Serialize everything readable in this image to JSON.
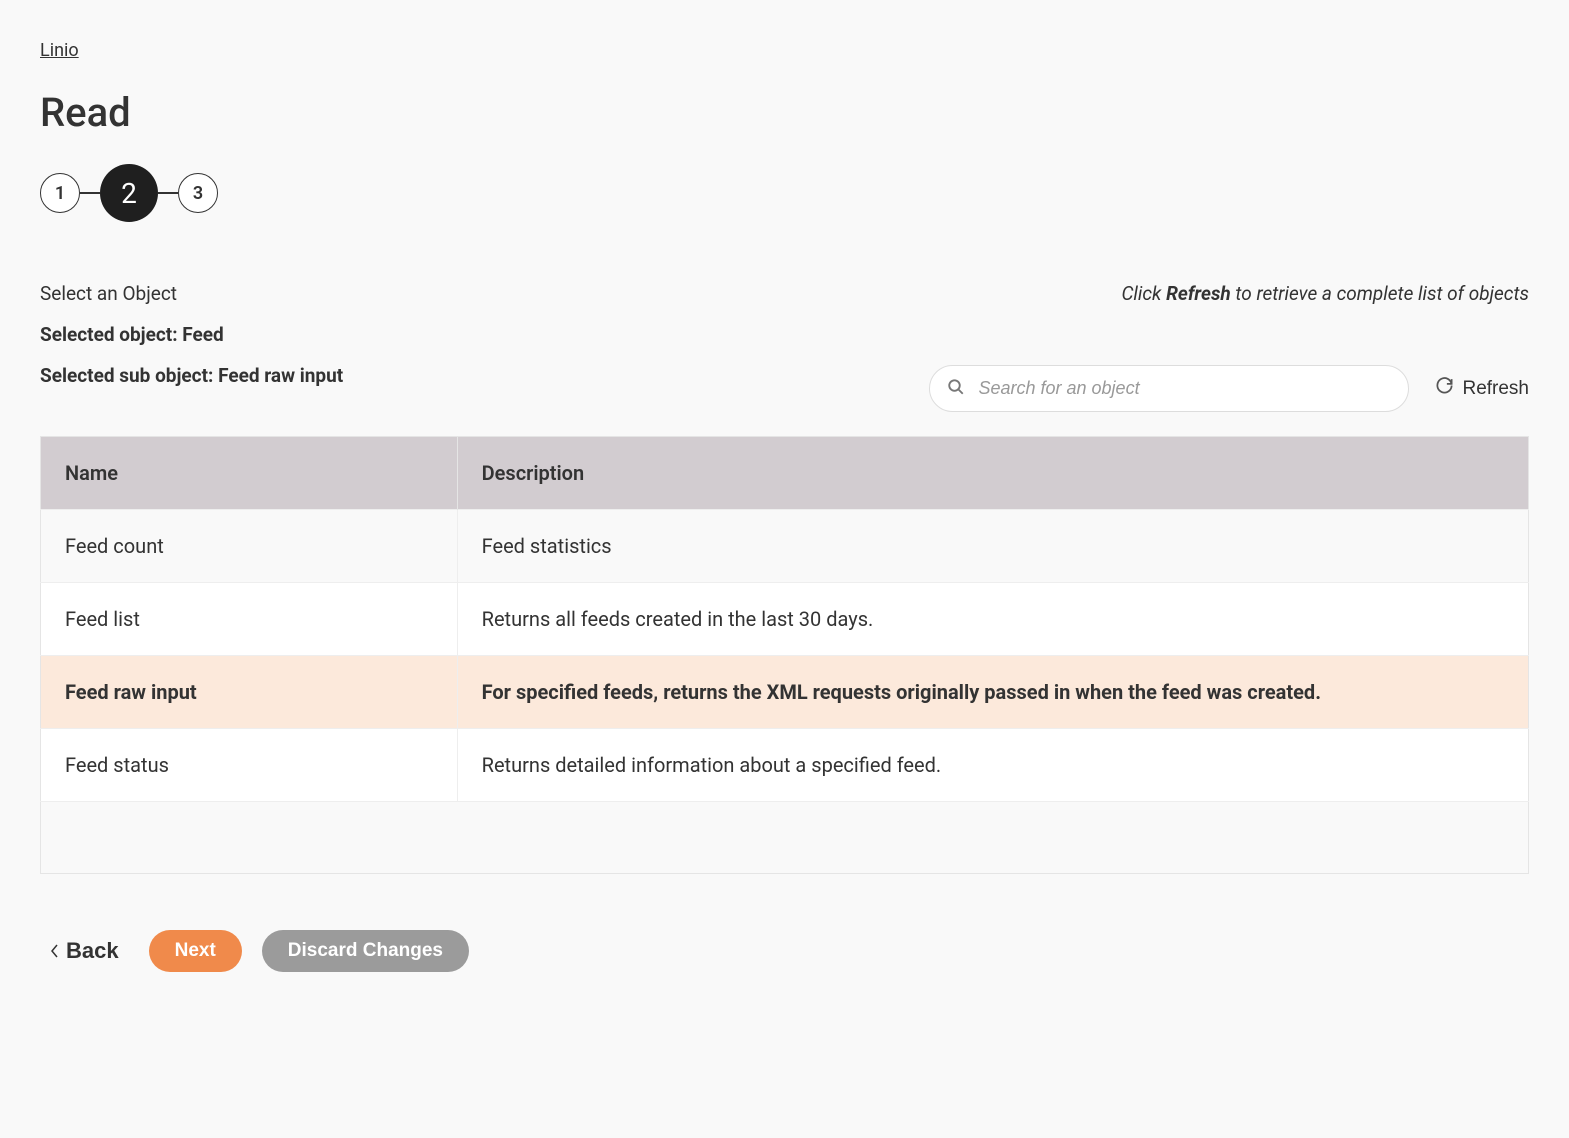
{
  "breadcrumb": {
    "label": "Linio"
  },
  "page_title": "Read",
  "stepper": {
    "steps": [
      "1",
      "2",
      "3"
    ],
    "active_index": 1
  },
  "section": {
    "label": "Select an Object",
    "hint_prefix": "Click ",
    "hint_strong": "Refresh",
    "hint_suffix": " to retrieve a complete list of objects"
  },
  "selected_object_line": "Selected object: Feed",
  "selected_sub_object_line": "Selected sub object: Feed raw input",
  "search": {
    "placeholder": "Search for an object"
  },
  "refresh_label": "Refresh",
  "table": {
    "headers": {
      "name": "Name",
      "description": "Description"
    },
    "rows": [
      {
        "name": "Feed count",
        "description": "Feed statistics",
        "selected": false
      },
      {
        "name": "Feed list",
        "description": "Returns all feeds created in the last 30 days.",
        "selected": false
      },
      {
        "name": "Feed raw input",
        "description": "For specified feeds, returns the XML requests originally passed in when the feed was created.",
        "selected": true
      },
      {
        "name": "Feed status",
        "description": "Returns detailed information about a specified feed.",
        "selected": false
      }
    ]
  },
  "footer": {
    "back_label": "Back",
    "next_label": "Next",
    "discard_label": "Discard Changes"
  }
}
